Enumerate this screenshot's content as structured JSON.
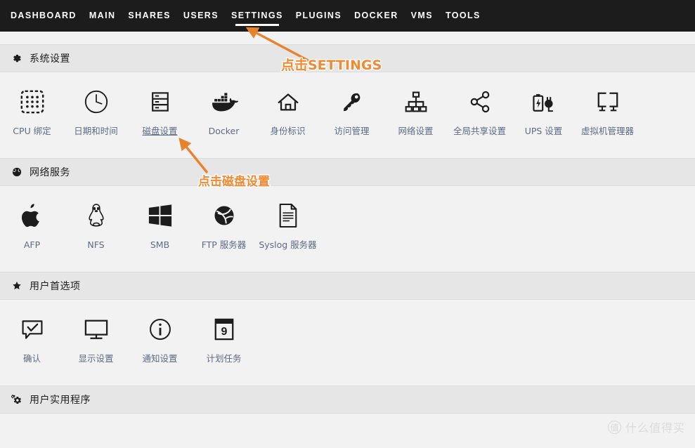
{
  "nav": {
    "items": [
      {
        "label": "DASHBOARD",
        "active": false
      },
      {
        "label": "MAIN",
        "active": false
      },
      {
        "label": "SHARES",
        "active": false
      },
      {
        "label": "USERS",
        "active": false
      },
      {
        "label": "SETTINGS",
        "active": true
      },
      {
        "label": "PLUGINS",
        "active": false
      },
      {
        "label": "DOCKER",
        "active": false
      },
      {
        "label": "VMS",
        "active": false
      },
      {
        "label": "TOOLS",
        "active": false
      }
    ]
  },
  "sections": [
    {
      "title": "系统设置",
      "icon": "gear-icon",
      "tiles": [
        {
          "label": "CPU 绑定",
          "icon": "cpu-pinning-icon",
          "hovered": false
        },
        {
          "label": "日期和时间",
          "icon": "clock-icon",
          "hovered": false
        },
        {
          "label": "磁盘设置",
          "icon": "disk-rack-icon",
          "hovered": true
        },
        {
          "label": "Docker",
          "icon": "docker-whale-icon",
          "hovered": false
        },
        {
          "label": "身份标识",
          "icon": "home-icon",
          "hovered": false
        },
        {
          "label": "访问管理",
          "icon": "key-icon",
          "hovered": false
        },
        {
          "label": "网络设置",
          "icon": "sitemap-icon",
          "hovered": false
        },
        {
          "label": "全局共享设置",
          "icon": "share-nodes-icon",
          "hovered": false
        },
        {
          "label": "UPS 设置",
          "icon": "ups-battery-icon",
          "hovered": false
        },
        {
          "label": "虚拟机管理器",
          "icon": "vm-screens-icon",
          "hovered": false
        }
      ]
    },
    {
      "title": "网络服务",
      "icon": "globe-icon",
      "tiles": [
        {
          "label": "AFP",
          "icon": "apple-icon",
          "hovered": false
        },
        {
          "label": "NFS",
          "icon": "linux-tux-icon",
          "hovered": false
        },
        {
          "label": "SMB",
          "icon": "windows-icon",
          "hovered": false
        },
        {
          "label": "FTP 服务器",
          "icon": "ftp-globe-icon",
          "hovered": false
        },
        {
          "label": "Syslog 服务器",
          "icon": "document-icon",
          "hovered": false
        }
      ]
    },
    {
      "title": "用户首选项",
      "icon": "star-icon",
      "tiles": [
        {
          "label": "确认",
          "icon": "comment-check-icon",
          "hovered": false
        },
        {
          "label": "显示设置",
          "icon": "monitor-icon",
          "hovered": false
        },
        {
          "label": "通知设置",
          "icon": "info-circle-icon",
          "hovered": false
        },
        {
          "label": "计划任务",
          "icon": "calendar-icon",
          "hovered": false
        }
      ]
    },
    {
      "title": "用户实用程序",
      "icon": "cogs-icon",
      "tiles": []
    }
  ],
  "annotations": [
    {
      "id": "anno1",
      "text": "点击SETTINGS"
    },
    {
      "id": "anno2",
      "text": "点击磁盘设置"
    }
  ],
  "watermark": {
    "badge": "值",
    "text": "什么值得买"
  },
  "calendar_day": "9",
  "colors": {
    "navbar_bg": "#1c1c1c",
    "section_bg": "#e6e6e6",
    "page_bg": "#f2f2f2",
    "label_blue": "#5d6b85",
    "annotation_orange": "#f08a33",
    "icon_dark": "#1d1d1d"
  }
}
